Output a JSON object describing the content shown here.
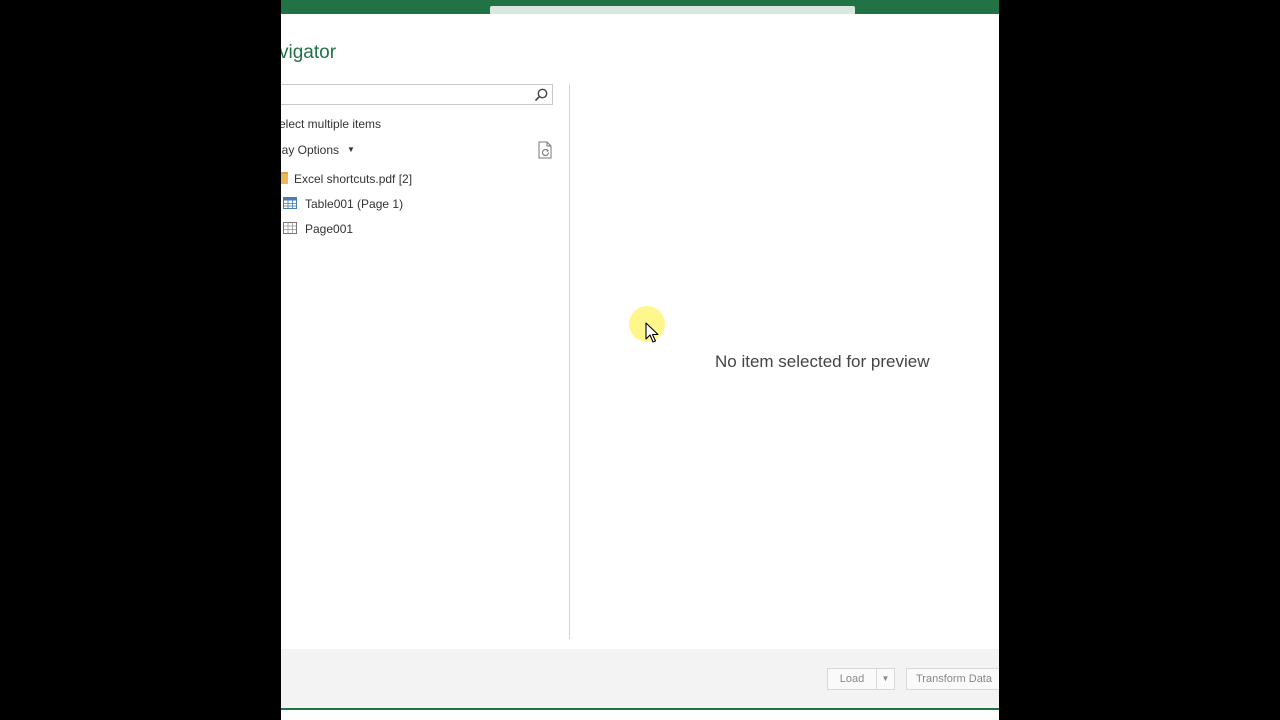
{
  "dialog": {
    "title": "vigator",
    "select_multiple_label": "elect multiple items",
    "display_options_label": "lay Options",
    "search": {
      "value": "",
      "placeholder": ""
    }
  },
  "tree": {
    "folder_label": "Excel shortcuts.pdf [2]",
    "items": [
      {
        "label": "Table001 (Page 1)",
        "icon": "table-icon"
      },
      {
        "label": "Page001",
        "icon": "page-icon"
      }
    ]
  },
  "preview": {
    "message": "No item selected for preview"
  },
  "footer": {
    "load_label": "Load",
    "transform_label": "Transform Data"
  },
  "colors": {
    "accent": "#217346",
    "folder": "#e8b85a",
    "highlight": "#fff578"
  }
}
